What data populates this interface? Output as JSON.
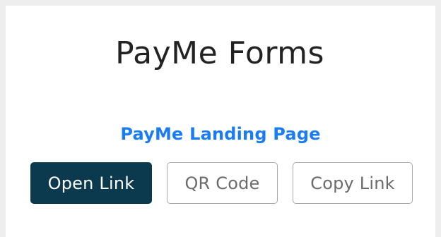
{
  "page": {
    "title": "PayMe Forms",
    "landing_link_text": "PayMe Landing Page"
  },
  "buttons": {
    "open_link": "Open Link",
    "qr_code": "QR Code",
    "copy_link": "Copy Link"
  },
  "colors": {
    "background": "#eeeeee",
    "card": "#ffffff",
    "title_text": "#222222",
    "link": "#1a7cf4",
    "primary_button": "#0b3a4f",
    "outline_border": "#a9a9a9",
    "outline_text": "#6b6b6b"
  }
}
